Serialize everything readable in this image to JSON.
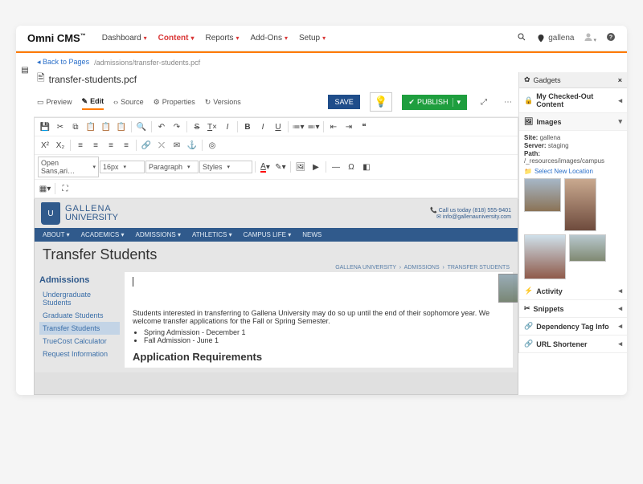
{
  "brand": "Omni CMS",
  "topnav": [
    "Dashboard",
    "Content",
    "Reports",
    "Add-Ons",
    "Setup"
  ],
  "site_name": "gallena",
  "back_label": "Back to Pages",
  "breadcrumb_path": "/admissions/transfer-students.pcf",
  "file_name": "transfer-students.pcf",
  "tabs": {
    "preview": "Preview",
    "edit": "Edit",
    "source": "Source",
    "properties": "Properties",
    "versions": "Versions"
  },
  "buttons": {
    "save": "SAVE",
    "publish": "PUBLISH"
  },
  "toolbar": {
    "font": "Open Sans,ari…",
    "size": "16px",
    "para": "Paragraph",
    "styles": "Styles"
  },
  "gadgets": {
    "title": "Gadgets",
    "rows": [
      "My Checked-Out Content",
      "Images",
      "Activity",
      "Snippets",
      "Dependency Tag Info",
      "URL Shortener"
    ],
    "images": {
      "site": "gallena",
      "server": "staging",
      "path": "/_resources/images/campus",
      "select": "Select New Location"
    }
  },
  "page": {
    "univ_top": "GALLENA",
    "univ_bot": "UNIVERSITY",
    "phone": "Call us today (818) 555-9401",
    "email": "info@gallenauniversity.com",
    "nav": [
      "ABOUT",
      "ACADEMICS",
      "ADMISSIONS",
      "ATHLETICS",
      "CAMPUS LIFE",
      "NEWS"
    ],
    "title": "Transfer Students",
    "bc": [
      "GALLENA UNIVERSITY",
      "ADMISSIONS",
      "TRANSFER STUDENTS"
    ],
    "sidenav_title": "Admissions",
    "sidenav": [
      "Undergraduate Students",
      "Graduate Students",
      "Transfer Students",
      "TrueCost Calculator",
      "Request Information"
    ],
    "intro": "Students interested in transferring to Gallena University may do so up until the end of their sophomore year. We welcome transfer applications for the Fall or Spring Semester.",
    "bullets": [
      "Spring Admission - December 1",
      "Fall Admission - June 1"
    ],
    "h2": "Application Requirements"
  }
}
